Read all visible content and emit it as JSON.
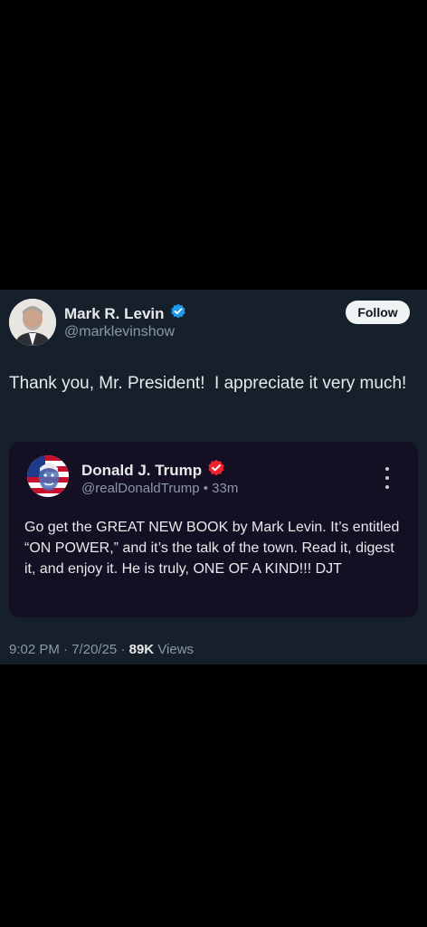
{
  "author": {
    "name": "Mark R. Levin",
    "handle": "@marklevinshow",
    "verified_color": "#1d9bf0"
  },
  "follow_label": "Follow",
  "tweet_text": "Thank you, Mr. President!  I appreciate it very much!",
  "quoted": {
    "name": "Donald J. Trump",
    "handle": "@realDonaldTrump",
    "separator": "•",
    "time": "33m",
    "verified_color": "#f4212e",
    "text": "Go get the GREAT NEW BOOK by Mark Levin. It’s entitled “ON POWER,” and it’s the talk of the town. Read it, digest it, and enjoy it. He is truly, ONE OF A KIND!!! DJT"
  },
  "footer": {
    "time": "9:02 PM",
    "date": "7/20/25",
    "dot": "·",
    "views_count": "89K",
    "views_label": "Views"
  },
  "colors": {
    "background": "#000000",
    "panel": "#15202b",
    "quote_card": "#140f23",
    "text_primary": "#e7e9ea",
    "text_secondary": "#8b98a5"
  },
  "icons": [
    "verified-badge-icon",
    "verified-badge-icon-red",
    "more-options-icon"
  ]
}
